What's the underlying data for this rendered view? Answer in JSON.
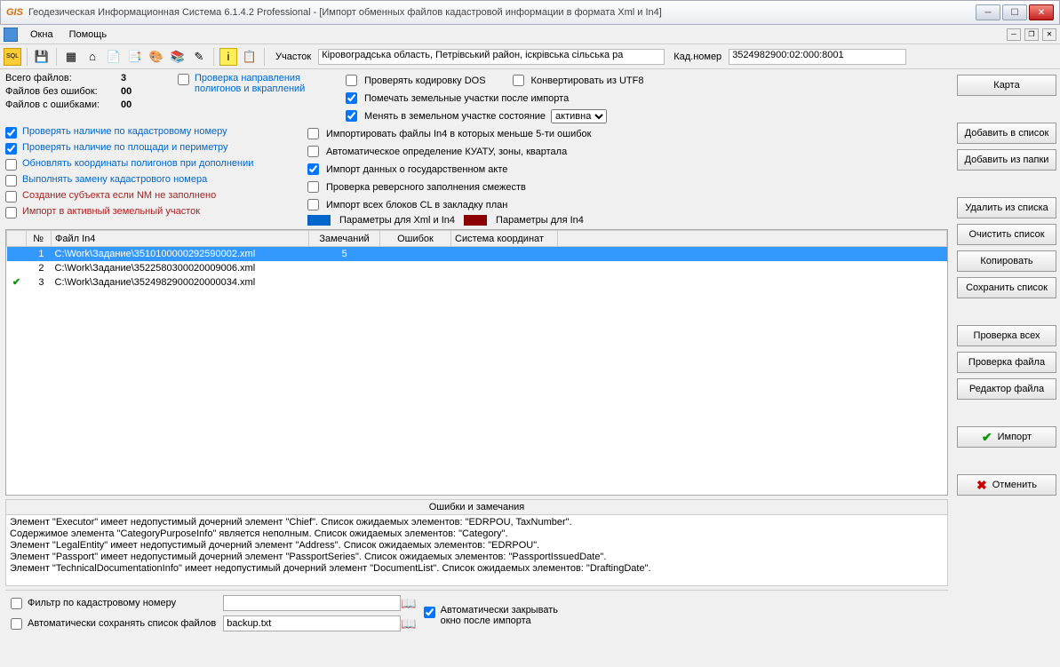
{
  "window": {
    "title": "Геодезическая Информационная Система 6.1.4.2 Professional - [Импорт обменных файлов кадастровой информации в формата Xml и In4]"
  },
  "menu": {
    "okna": "Окна",
    "help": "Помощь"
  },
  "toolbar": {
    "parcel_label": "Участок",
    "parcel_value": "Кіровоградська область, Петрівський район, іскрівська сільська ра",
    "cad_label": "Кад.номер",
    "cad_value": "3524982900:02:000:8001"
  },
  "stats": {
    "total_label": "Всего файлов:",
    "total_val": "3",
    "noerr_label": "Файлов без ошибок:",
    "noerr_val": "00",
    "err_label": "Файлов с ошибками:",
    "err_val": "00"
  },
  "checks_left": {
    "polygon": "Проверка направления полигонов и вкраплений",
    "c1": "Проверять наличие по кадастровому номеру",
    "c2": "Проверять наличие по площади и периметру",
    "c3": "Обновлять координаты полигонов при дополнении",
    "c4": "Выполнять замену кадастрового номера",
    "c5": "Создание субъекта если NM не заполнено",
    "c6": "Импорт в активный земельный участок"
  },
  "checks_mid": {
    "m1": "Проверять кодировку DOS",
    "m2": "Конвертировать из UTF8",
    "m3": "Помечать земельные участки после импорта",
    "m4": "Менять в земельном участке состояние",
    "m4_sel": "активна",
    "m5": "Импортировать файлы In4 в которых меньше 5-ти ошибок",
    "m6": "Автоматическое определение КУАТУ, зоны, квартала",
    "m7": "Импорт данных о государственном акте",
    "m8": "Проверка реверсного заполнения смежеств",
    "m9": "Импорт всех блоков CL в закладку план",
    "leg1": "Параметры для Xml и In4",
    "leg2": "Параметры для In4"
  },
  "grid": {
    "h_num": "№",
    "h_file": "Файл In4",
    "h_notes": "Замечаний",
    "h_err": "Ошибок",
    "h_cs": "Система координат",
    "rows": [
      {
        "n": "1",
        "file": "C:\\Work\\Задание\\3510100000292590002.xml",
        "notes": "5",
        "err": "",
        "cs": "",
        "sel": true,
        "ok": false
      },
      {
        "n": "2",
        "file": "C:\\Work\\Задание\\3522580300020009006.xml",
        "notes": "",
        "err": "",
        "cs": "",
        "sel": false,
        "ok": false
      },
      {
        "n": "3",
        "file": "C:\\Work\\Задание\\3524982900020000034.xml",
        "notes": "",
        "err": "",
        "cs": "",
        "sel": false,
        "ok": true
      }
    ]
  },
  "errors": {
    "header": "Ошибки и замечания",
    "lines": [
      "Элемент \"Executor\" имеет недопустимый дочерний элемент \"Chief\". Список ожидаемых элементов: \"EDRPOU, TaxNumber\".",
      "Содержимое элемента \"CategoryPurposeInfo\" является неполным. Список ожидаемых элементов: \"Category\".",
      "Элемент \"LegalEntity\" имеет недопустимый дочерний элемент \"Address\". Список ожидаемых элементов: \"EDRPOU\".",
      "Элемент \"Passport\" имеет недопустимый дочерний элемент \"PassportSeries\". Список ожидаемых элементов: \"PassportIssuedDate\".",
      "Элемент \"TechnicalDocumentationInfo\" имеет недопустимый дочерний элемент \"DocumentList\". Список ожидаемых элементов: \"DraftingDate\"."
    ]
  },
  "bottom": {
    "filter": "Фильтр по кадастровому номеру",
    "autosave": "Автоматически сохранять список файлов",
    "autosave_val": "backup.txt",
    "autoclose": "Автоматически закрывать окно после импорта"
  },
  "buttons": {
    "map": "Карта",
    "add_list": "Добавить в список",
    "add_folder": "Добавить из папки",
    "remove": "Удалить из списка",
    "clear": "Очистить список",
    "copy": "Копировать",
    "save": "Сохранить список",
    "check_all": "Проверка всех",
    "check_file": "Проверка файла",
    "edit_file": "Редактор файла",
    "import": "Импорт",
    "cancel": "Отменить"
  }
}
